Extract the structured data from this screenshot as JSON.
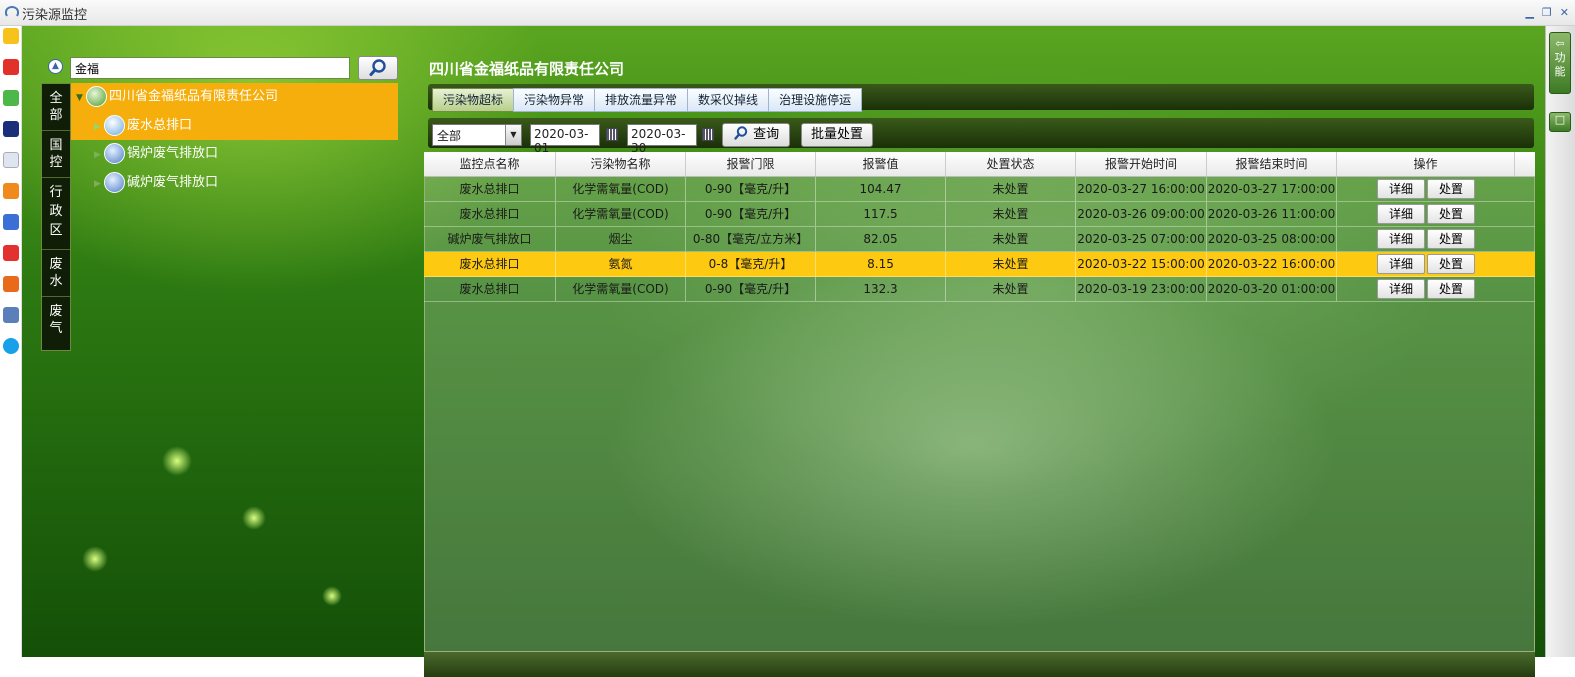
{
  "window": {
    "title": "污染源监控"
  },
  "search": {
    "value": "金福"
  },
  "side_tabs": [
    "全部",
    "国控",
    "行政区",
    "废水",
    "废气"
  ],
  "right_tabs": [
    "功能"
  ],
  "tree": {
    "root": "四川省金福纸品有限责任公司",
    "children": [
      "废水总排口",
      "锅炉废气排放口",
      "碱炉废气排放口"
    ],
    "selected": "废水总排口"
  },
  "company_title": "四川省金福纸品有限责任公司",
  "tabs": [
    "污染物超标",
    "污染物异常",
    "排放流量异常",
    "数采仪掉线",
    "治理设施停运"
  ],
  "active_tab": "污染物超标",
  "filter": {
    "type": "全部",
    "start_date": "2020-03-01",
    "end_date": "2020-03-30",
    "query_label": "查询",
    "batch_label": "批量处置"
  },
  "table": {
    "headers": [
      "监控点名称",
      "污染物名称",
      "报警门限",
      "报警值",
      "处置状态",
      "报警开始时间",
      "报警结束时间",
      "操作"
    ],
    "rows": [
      [
        "废水总排口",
        "化学需氧量(COD)",
        "0-90【毫克/升】",
        "104.47",
        "未处置",
        "2020-03-27 16:00:00",
        "2020-03-27 17:00:00"
      ],
      [
        "废水总排口",
        "化学需氧量(COD)",
        "0-90【毫克/升】",
        "117.5",
        "未处置",
        "2020-03-26 09:00:00",
        "2020-03-26 11:00:00"
      ],
      [
        "碱炉废气排放口",
        "烟尘",
        "0-80【毫克/立方米】",
        "82.05",
        "未处置",
        "2020-03-25 07:00:00",
        "2020-03-25 08:00:00"
      ],
      [
        "废水总排口",
        "氨氮",
        "0-8【毫克/升】",
        "8.15",
        "未处置",
        "2020-03-22 15:00:00",
        "2020-03-22 16:00:00"
      ],
      [
        "废水总排口",
        "化学需氧量(COD)",
        "0-90【毫克/升】",
        "132.3",
        "未处置",
        "2020-03-19 23:00:00",
        "2020-03-20 01:00:00"
      ]
    ],
    "selected_row": 3,
    "action_labels": [
      "详细",
      "处置"
    ]
  },
  "colors": {
    "selection": "#fec911",
    "tree_selection": "#f6ae0c",
    "panel_green": "#2d7a12"
  }
}
